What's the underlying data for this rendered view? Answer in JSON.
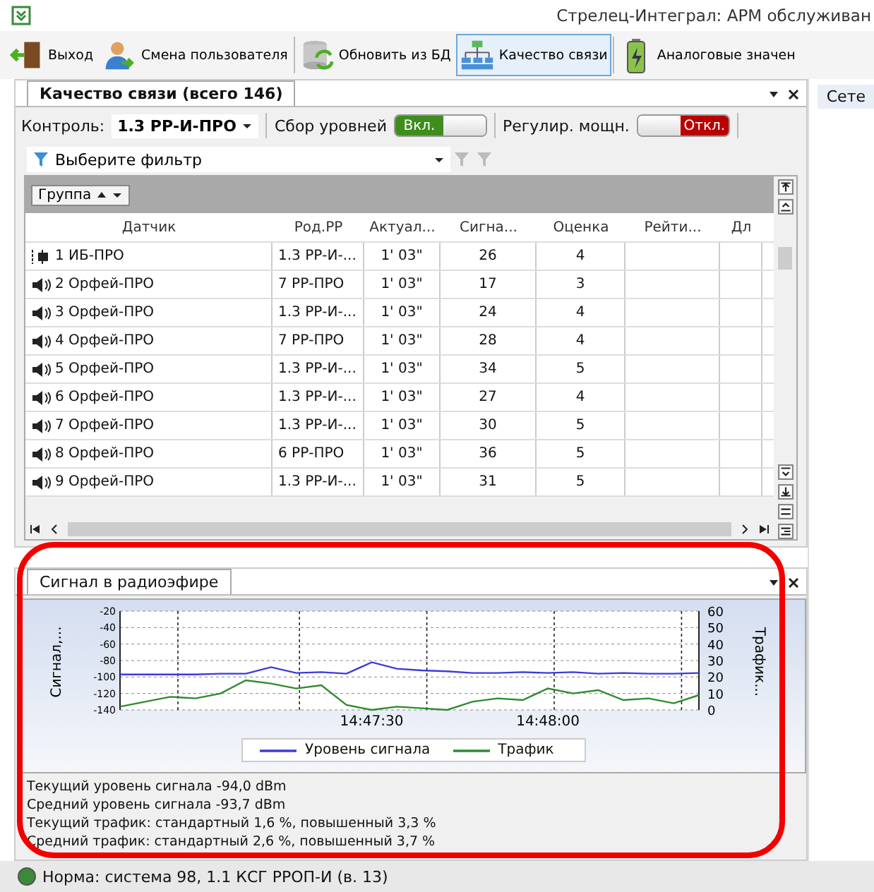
{
  "window": {
    "title": "Стрелец-Интеграл: АРМ обслуживан"
  },
  "toolbar": [
    {
      "label": "Выход",
      "selected": false
    },
    {
      "label": "Смена пользователя",
      "selected": false
    },
    {
      "label": "Обновить из БД",
      "selected": false
    },
    {
      "label": "Качество связи",
      "selected": true
    },
    {
      "label": "Аналоговые значен",
      "selected": false
    }
  ],
  "side_tab": "Сете",
  "panel": {
    "tab": "Качество связи (всего 146)",
    "control_label": "Контроль:",
    "control_value": "1.3 РР-И-ПРО",
    "collect_label": "Сбор уровней",
    "collect_toggle": {
      "text": "Вкл.",
      "on": true
    },
    "power_label": "Регулир. мощн.",
    "power_toggle": {
      "text": "Откл.",
      "on": false
    },
    "filter": "Выберите фильтр",
    "group_chip": "Группа",
    "columns": [
      "Датчик",
      "Род.РР",
      "Актуал...",
      "Сигна...",
      "Оценка",
      "Рейти...",
      "Дл"
    ],
    "rows": [
      {
        "kind": "device",
        "cells": [
          "1 ИБ-ПРО",
          "1.3 РР-И-...",
          "1' 03\"",
          "26",
          "4"
        ]
      },
      {
        "kind": "speaker",
        "cells": [
          "2 Орфей-ПРО",
          "7 РР-ПРО",
          "1' 03\"",
          "17",
          "3"
        ]
      },
      {
        "kind": "speaker",
        "cells": [
          "3 Орфей-ПРО",
          "1.3 РР-И-...",
          "1' 03\"",
          "24",
          "4"
        ]
      },
      {
        "kind": "speaker",
        "cells": [
          "4 Орфей-ПРО",
          "7 РР-ПРО",
          "1' 03\"",
          "28",
          "4"
        ]
      },
      {
        "kind": "speaker",
        "cells": [
          "5 Орфей-ПРО",
          "1.3 РР-И-...",
          "1' 03\"",
          "34",
          "5"
        ]
      },
      {
        "kind": "speaker",
        "cells": [
          "6 Орфей-ПРО",
          "1.3 РР-И-...",
          "1' 03\"",
          "27",
          "4"
        ]
      },
      {
        "kind": "speaker",
        "cells": [
          "7 Орфей-ПРО",
          "1.3 РР-И-...",
          "1' 03\"",
          "30",
          "5"
        ]
      },
      {
        "kind": "speaker",
        "cells": [
          "8 Орфей-ПРО",
          "6 РР-ПРО",
          "1' 03\"",
          "36",
          "5"
        ]
      },
      {
        "kind": "speaker",
        "cells": [
          "9 Орфей-ПРО",
          "1.3 РР-И-...",
          "1' 03\"",
          "31",
          "5"
        ]
      }
    ]
  },
  "signal_panel": {
    "tab": "Сигнал в радиоэфире",
    "chart_data": {
      "type": "line",
      "ylabel": "Сигнал,...",
      "y2label": "Трафик...",
      "categories": [
        null,
        null,
        null,
        null,
        null,
        null,
        null,
        null,
        null,
        null,
        "14:47:30",
        null,
        null,
        null,
        null,
        null,
        null,
        "14:48:00",
        null,
        null,
        null,
        null,
        null,
        null
      ],
      "ylim": [
        -140,
        -20
      ],
      "y2lim": [
        0,
        60
      ],
      "grid": true,
      "legend": "bottom",
      "yticks": [
        -140,
        -120,
        -100,
        -80,
        -60,
        -40,
        -20
      ],
      "y2ticks": [
        0,
        10,
        20,
        30,
        40,
        50,
        60
      ],
      "series": [
        {
          "name": "Уровень сигнала",
          "color": "#3b3bdc",
          "values": [
            -97,
            -97,
            -97,
            -97,
            -96,
            -96,
            -88,
            -95,
            -94,
            -96,
            -82,
            -90,
            -92,
            -93,
            -95,
            -95,
            -94,
            -95,
            -94,
            -96,
            -95,
            -96,
            -96,
            -95
          ]
        },
        {
          "name": "Трафик",
          "color": "#2e8b2e",
          "axis": "y2",
          "values": [
            2,
            5,
            8,
            7,
            10,
            18,
            16,
            13,
            15,
            3,
            0,
            2,
            1,
            0,
            5,
            7,
            6,
            13,
            10,
            12,
            6,
            7,
            4,
            9
          ]
        }
      ]
    },
    "stats": [
      "Текущий уровень сигнала -94,0 dBm",
      "Средний уровень сигнала -93,7 dBm",
      "Текущий трафик: стандартный 1,6 %, повышенный 3,3 %",
      "Средний трафик: стандартный 2,6 %, повышенный 3,7 %"
    ]
  },
  "status_bar": {
    "text": "Норма:  система 98, 1.1 КСГ РРОП-И (в. 13)"
  }
}
